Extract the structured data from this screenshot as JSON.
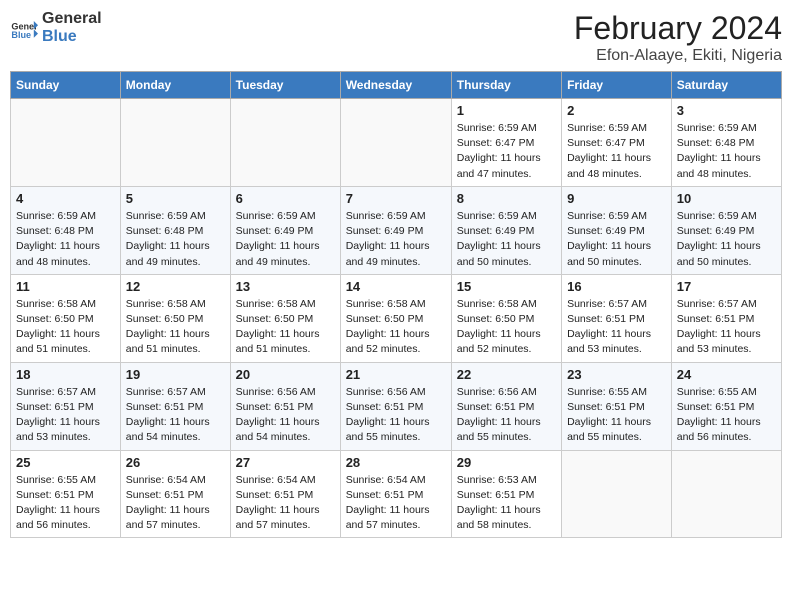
{
  "header": {
    "logo_line1": "General",
    "logo_line2": "Blue",
    "month_year": "February 2024",
    "location": "Efon-Alaaye, Ekiti, Nigeria"
  },
  "days_of_week": [
    "Sunday",
    "Monday",
    "Tuesday",
    "Wednesday",
    "Thursday",
    "Friday",
    "Saturday"
  ],
  "weeks": [
    [
      {
        "day": "",
        "info": ""
      },
      {
        "day": "",
        "info": ""
      },
      {
        "day": "",
        "info": ""
      },
      {
        "day": "",
        "info": ""
      },
      {
        "day": "1",
        "info": "Sunrise: 6:59 AM\nSunset: 6:47 PM\nDaylight: 11 hours and 47 minutes."
      },
      {
        "day": "2",
        "info": "Sunrise: 6:59 AM\nSunset: 6:47 PM\nDaylight: 11 hours and 48 minutes."
      },
      {
        "day": "3",
        "info": "Sunrise: 6:59 AM\nSunset: 6:48 PM\nDaylight: 11 hours and 48 minutes."
      }
    ],
    [
      {
        "day": "4",
        "info": "Sunrise: 6:59 AM\nSunset: 6:48 PM\nDaylight: 11 hours and 48 minutes."
      },
      {
        "day": "5",
        "info": "Sunrise: 6:59 AM\nSunset: 6:48 PM\nDaylight: 11 hours and 49 minutes."
      },
      {
        "day": "6",
        "info": "Sunrise: 6:59 AM\nSunset: 6:49 PM\nDaylight: 11 hours and 49 minutes."
      },
      {
        "day": "7",
        "info": "Sunrise: 6:59 AM\nSunset: 6:49 PM\nDaylight: 11 hours and 49 minutes."
      },
      {
        "day": "8",
        "info": "Sunrise: 6:59 AM\nSunset: 6:49 PM\nDaylight: 11 hours and 50 minutes."
      },
      {
        "day": "9",
        "info": "Sunrise: 6:59 AM\nSunset: 6:49 PM\nDaylight: 11 hours and 50 minutes."
      },
      {
        "day": "10",
        "info": "Sunrise: 6:59 AM\nSunset: 6:49 PM\nDaylight: 11 hours and 50 minutes."
      }
    ],
    [
      {
        "day": "11",
        "info": "Sunrise: 6:58 AM\nSunset: 6:50 PM\nDaylight: 11 hours and 51 minutes."
      },
      {
        "day": "12",
        "info": "Sunrise: 6:58 AM\nSunset: 6:50 PM\nDaylight: 11 hours and 51 minutes."
      },
      {
        "day": "13",
        "info": "Sunrise: 6:58 AM\nSunset: 6:50 PM\nDaylight: 11 hours and 51 minutes."
      },
      {
        "day": "14",
        "info": "Sunrise: 6:58 AM\nSunset: 6:50 PM\nDaylight: 11 hours and 52 minutes."
      },
      {
        "day": "15",
        "info": "Sunrise: 6:58 AM\nSunset: 6:50 PM\nDaylight: 11 hours and 52 minutes."
      },
      {
        "day": "16",
        "info": "Sunrise: 6:57 AM\nSunset: 6:51 PM\nDaylight: 11 hours and 53 minutes."
      },
      {
        "day": "17",
        "info": "Sunrise: 6:57 AM\nSunset: 6:51 PM\nDaylight: 11 hours and 53 minutes."
      }
    ],
    [
      {
        "day": "18",
        "info": "Sunrise: 6:57 AM\nSunset: 6:51 PM\nDaylight: 11 hours and 53 minutes."
      },
      {
        "day": "19",
        "info": "Sunrise: 6:57 AM\nSunset: 6:51 PM\nDaylight: 11 hours and 54 minutes."
      },
      {
        "day": "20",
        "info": "Sunrise: 6:56 AM\nSunset: 6:51 PM\nDaylight: 11 hours and 54 minutes."
      },
      {
        "day": "21",
        "info": "Sunrise: 6:56 AM\nSunset: 6:51 PM\nDaylight: 11 hours and 55 minutes."
      },
      {
        "day": "22",
        "info": "Sunrise: 6:56 AM\nSunset: 6:51 PM\nDaylight: 11 hours and 55 minutes."
      },
      {
        "day": "23",
        "info": "Sunrise: 6:55 AM\nSunset: 6:51 PM\nDaylight: 11 hours and 55 minutes."
      },
      {
        "day": "24",
        "info": "Sunrise: 6:55 AM\nSunset: 6:51 PM\nDaylight: 11 hours and 56 minutes."
      }
    ],
    [
      {
        "day": "25",
        "info": "Sunrise: 6:55 AM\nSunset: 6:51 PM\nDaylight: 11 hours and 56 minutes."
      },
      {
        "day": "26",
        "info": "Sunrise: 6:54 AM\nSunset: 6:51 PM\nDaylight: 11 hours and 57 minutes."
      },
      {
        "day": "27",
        "info": "Sunrise: 6:54 AM\nSunset: 6:51 PM\nDaylight: 11 hours and 57 minutes."
      },
      {
        "day": "28",
        "info": "Sunrise: 6:54 AM\nSunset: 6:51 PM\nDaylight: 11 hours and 57 minutes."
      },
      {
        "day": "29",
        "info": "Sunrise: 6:53 AM\nSunset: 6:51 PM\nDaylight: 11 hours and 58 minutes."
      },
      {
        "day": "",
        "info": ""
      },
      {
        "day": "",
        "info": ""
      }
    ]
  ]
}
